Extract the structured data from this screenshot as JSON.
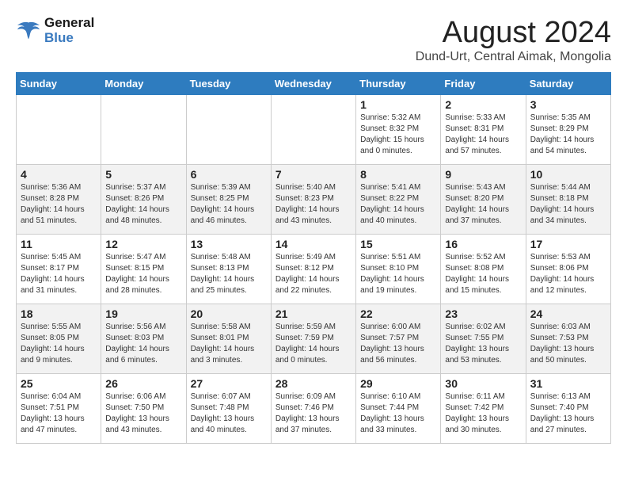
{
  "header": {
    "logo_line1": "General",
    "logo_line2": "Blue",
    "main_title": "August 2024",
    "subtitle": "Dund-Urt, Central Aimak, Mongolia"
  },
  "weekdays": [
    "Sunday",
    "Monday",
    "Tuesday",
    "Wednesday",
    "Thursday",
    "Friday",
    "Saturday"
  ],
  "weeks": [
    [
      {
        "day": "",
        "info": ""
      },
      {
        "day": "",
        "info": ""
      },
      {
        "day": "",
        "info": ""
      },
      {
        "day": "",
        "info": ""
      },
      {
        "day": "1",
        "info": "Sunrise: 5:32 AM\nSunset: 8:32 PM\nDaylight: 15 hours\nand 0 minutes."
      },
      {
        "day": "2",
        "info": "Sunrise: 5:33 AM\nSunset: 8:31 PM\nDaylight: 14 hours\nand 57 minutes."
      },
      {
        "day": "3",
        "info": "Sunrise: 5:35 AM\nSunset: 8:29 PM\nDaylight: 14 hours\nand 54 minutes."
      }
    ],
    [
      {
        "day": "4",
        "info": "Sunrise: 5:36 AM\nSunset: 8:28 PM\nDaylight: 14 hours\nand 51 minutes."
      },
      {
        "day": "5",
        "info": "Sunrise: 5:37 AM\nSunset: 8:26 PM\nDaylight: 14 hours\nand 48 minutes."
      },
      {
        "day": "6",
        "info": "Sunrise: 5:39 AM\nSunset: 8:25 PM\nDaylight: 14 hours\nand 46 minutes."
      },
      {
        "day": "7",
        "info": "Sunrise: 5:40 AM\nSunset: 8:23 PM\nDaylight: 14 hours\nand 43 minutes."
      },
      {
        "day": "8",
        "info": "Sunrise: 5:41 AM\nSunset: 8:22 PM\nDaylight: 14 hours\nand 40 minutes."
      },
      {
        "day": "9",
        "info": "Sunrise: 5:43 AM\nSunset: 8:20 PM\nDaylight: 14 hours\nand 37 minutes."
      },
      {
        "day": "10",
        "info": "Sunrise: 5:44 AM\nSunset: 8:18 PM\nDaylight: 14 hours\nand 34 minutes."
      }
    ],
    [
      {
        "day": "11",
        "info": "Sunrise: 5:45 AM\nSunset: 8:17 PM\nDaylight: 14 hours\nand 31 minutes."
      },
      {
        "day": "12",
        "info": "Sunrise: 5:47 AM\nSunset: 8:15 PM\nDaylight: 14 hours\nand 28 minutes."
      },
      {
        "day": "13",
        "info": "Sunrise: 5:48 AM\nSunset: 8:13 PM\nDaylight: 14 hours\nand 25 minutes."
      },
      {
        "day": "14",
        "info": "Sunrise: 5:49 AM\nSunset: 8:12 PM\nDaylight: 14 hours\nand 22 minutes."
      },
      {
        "day": "15",
        "info": "Sunrise: 5:51 AM\nSunset: 8:10 PM\nDaylight: 14 hours\nand 19 minutes."
      },
      {
        "day": "16",
        "info": "Sunrise: 5:52 AM\nSunset: 8:08 PM\nDaylight: 14 hours\nand 15 minutes."
      },
      {
        "day": "17",
        "info": "Sunrise: 5:53 AM\nSunset: 8:06 PM\nDaylight: 14 hours\nand 12 minutes."
      }
    ],
    [
      {
        "day": "18",
        "info": "Sunrise: 5:55 AM\nSunset: 8:05 PM\nDaylight: 14 hours\nand 9 minutes."
      },
      {
        "day": "19",
        "info": "Sunrise: 5:56 AM\nSunset: 8:03 PM\nDaylight: 14 hours\nand 6 minutes."
      },
      {
        "day": "20",
        "info": "Sunrise: 5:58 AM\nSunset: 8:01 PM\nDaylight: 14 hours\nand 3 minutes."
      },
      {
        "day": "21",
        "info": "Sunrise: 5:59 AM\nSunset: 7:59 PM\nDaylight: 14 hours\nand 0 minutes."
      },
      {
        "day": "22",
        "info": "Sunrise: 6:00 AM\nSunset: 7:57 PM\nDaylight: 13 hours\nand 56 minutes."
      },
      {
        "day": "23",
        "info": "Sunrise: 6:02 AM\nSunset: 7:55 PM\nDaylight: 13 hours\nand 53 minutes."
      },
      {
        "day": "24",
        "info": "Sunrise: 6:03 AM\nSunset: 7:53 PM\nDaylight: 13 hours\nand 50 minutes."
      }
    ],
    [
      {
        "day": "25",
        "info": "Sunrise: 6:04 AM\nSunset: 7:51 PM\nDaylight: 13 hours\nand 47 minutes."
      },
      {
        "day": "26",
        "info": "Sunrise: 6:06 AM\nSunset: 7:50 PM\nDaylight: 13 hours\nand 43 minutes."
      },
      {
        "day": "27",
        "info": "Sunrise: 6:07 AM\nSunset: 7:48 PM\nDaylight: 13 hours\nand 40 minutes."
      },
      {
        "day": "28",
        "info": "Sunrise: 6:09 AM\nSunset: 7:46 PM\nDaylight: 13 hours\nand 37 minutes."
      },
      {
        "day": "29",
        "info": "Sunrise: 6:10 AM\nSunset: 7:44 PM\nDaylight: 13 hours\nand 33 minutes."
      },
      {
        "day": "30",
        "info": "Sunrise: 6:11 AM\nSunset: 7:42 PM\nDaylight: 13 hours\nand 30 minutes."
      },
      {
        "day": "31",
        "info": "Sunrise: 6:13 AM\nSunset: 7:40 PM\nDaylight: 13 hours\nand 27 minutes."
      }
    ]
  ]
}
